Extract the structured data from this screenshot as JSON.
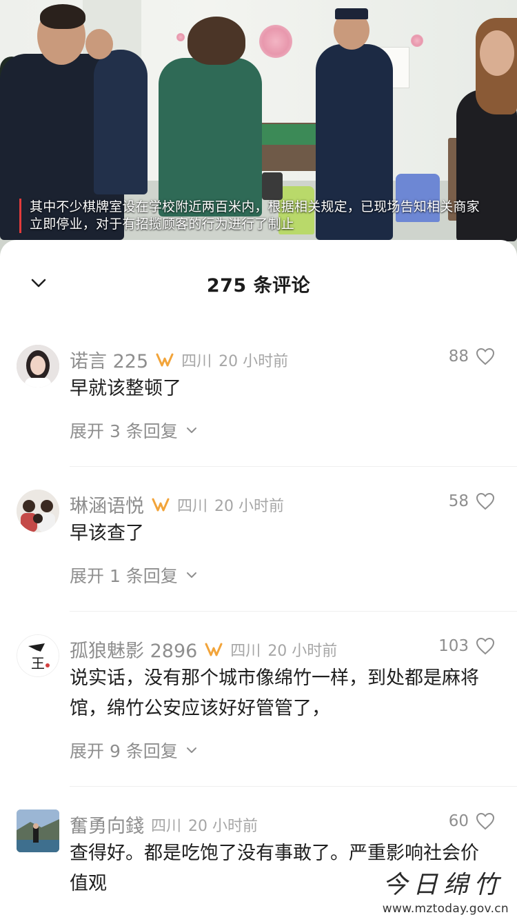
{
  "video": {
    "caption": "其中不少棋牌室设在学校附近两百米内，根据相关规定，已现场告知相关商家立即停业，对于有招揽顾客的行为进行了制止",
    "accent_color": "#e23b3b"
  },
  "sheet": {
    "title": "275 条评论",
    "collapse_icon": "chevron-down-icon"
  },
  "comments": [
    {
      "username": "诺言 225",
      "has_vip_badge": true,
      "location": "四川",
      "time": "20 小时前",
      "text": "早就该整顿了",
      "likes": "88",
      "expand_label": "展开 3 条回复"
    },
    {
      "username": "琳涵语悦",
      "has_vip_badge": true,
      "location": "四川",
      "time": "20 小时前",
      "text": "早该查了",
      "likes": "58",
      "expand_label": "展开 1 条回复"
    },
    {
      "username": "孤狼魅影 2896",
      "has_vip_badge": true,
      "location": "四川",
      "time": "20 小时前",
      "text": "说实话，没有那个城市像绵竹一样，到处都是麻将馆，绵竹公安应该好好管管了，",
      "likes": "103",
      "expand_label": "展开 9 条回复"
    },
    {
      "username": "奮勇向錢",
      "has_vip_badge": false,
      "location": "四川",
      "time": "20 小时前",
      "text": "查得好。都是吃饱了没有事敢了。严重影响社会价值观",
      "likes": "60",
      "expand_label": ""
    }
  ],
  "watermark": {
    "logo_text": "今日绵竹",
    "url": "www.mztoday.gov.cn"
  },
  "colors": {
    "vip_badge": "#f2a43a",
    "muted_text": "#8e8e8e"
  }
}
